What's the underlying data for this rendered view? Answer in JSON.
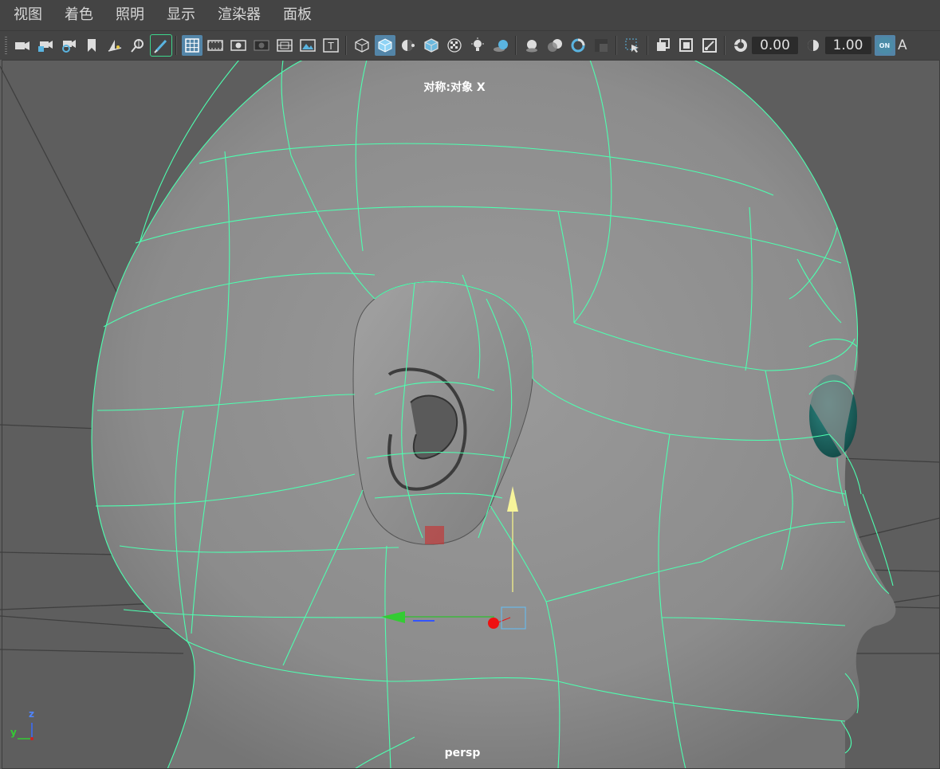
{
  "menu": {
    "items": [
      "视图",
      "着色",
      "照明",
      "显示",
      "渲染器",
      "面板"
    ]
  },
  "toolbar": {
    "icons": [
      "camera-select-icon",
      "camera-lock-icon",
      "camera-attributes-icon",
      "bookmark-icon",
      "image-plane-icon",
      "2d-pan-zoom-icon",
      "grease-pencil-icon",
      "grid-icon",
      "film-gate-icon",
      "resolution-gate-icon",
      "gate-mask-icon",
      "field-chart-icon",
      "safe-action-icon",
      "safe-title-icon",
      "wireframe-icon",
      "smooth-shade-icon",
      "default-material-icon",
      "wireframe-on-shaded-icon",
      "xray-icon",
      "lighting-icon",
      "shadows-icon",
      "ambient-occlusion-icon",
      "motion-blur-icon",
      "anti-alias-icon",
      "depth-of-field-icon",
      "isolate-select-icon",
      "xray-joints-icon",
      "xray-active-icon",
      "xray-all-icon",
      "exposure-icon",
      "gamma-icon",
      "color-management-icon"
    ],
    "exposure_value": "0.00",
    "gamma_value": "1.00",
    "color_mgmt_label": "ON",
    "trailing_letter": "A"
  },
  "viewport": {
    "symmetry_label": "对称:对象 X",
    "camera_name": "persp",
    "axis_z": "z",
    "axis_y": "y"
  },
  "colors": {
    "wireframe": "#4dffb0",
    "mesh_gray": "#8d8d8d",
    "background": "#5e5e5e",
    "active_button": "#5385a8",
    "eye_teal": "#1f6b66"
  }
}
